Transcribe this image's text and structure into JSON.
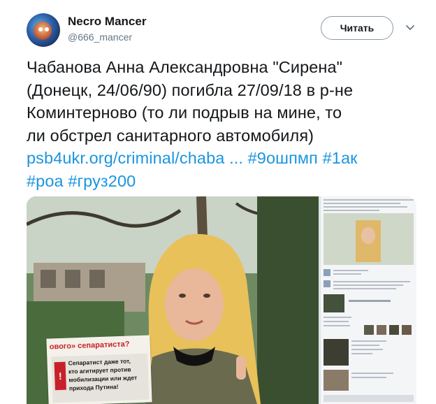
{
  "author": {
    "name": "Necro Mancer",
    "handle": "@666_mancer",
    "avatar_icon": "avatar-image"
  },
  "follow_label": "Читать",
  "tweet": {
    "lines": [
      "Чабанова Анна Александровна \"Сирена\"",
      "(Донецк, 24/06/90) погибла 27/09/18 в р-не",
      "Коминтерново (то ли подрыв на мине, то",
      "ли обстрел санитарного автомобиля)"
    ],
    "link": "psb4ukr.org/criminal/chaba ...",
    "hashtags": [
      "#9ошпмп",
      "#1ак",
      "#роа",
      "#груз200"
    ]
  },
  "photo_sign": {
    "header": "ового» сепаратиста?",
    "line1": "Сепаратист даже тот,",
    "line2": "кто агитирует против",
    "line3": "мобилизации или ждет",
    "line4": "прихода Путина!"
  },
  "colors": {
    "link": "#1b95e0",
    "text": "#14171a",
    "secondary": "#657786"
  }
}
